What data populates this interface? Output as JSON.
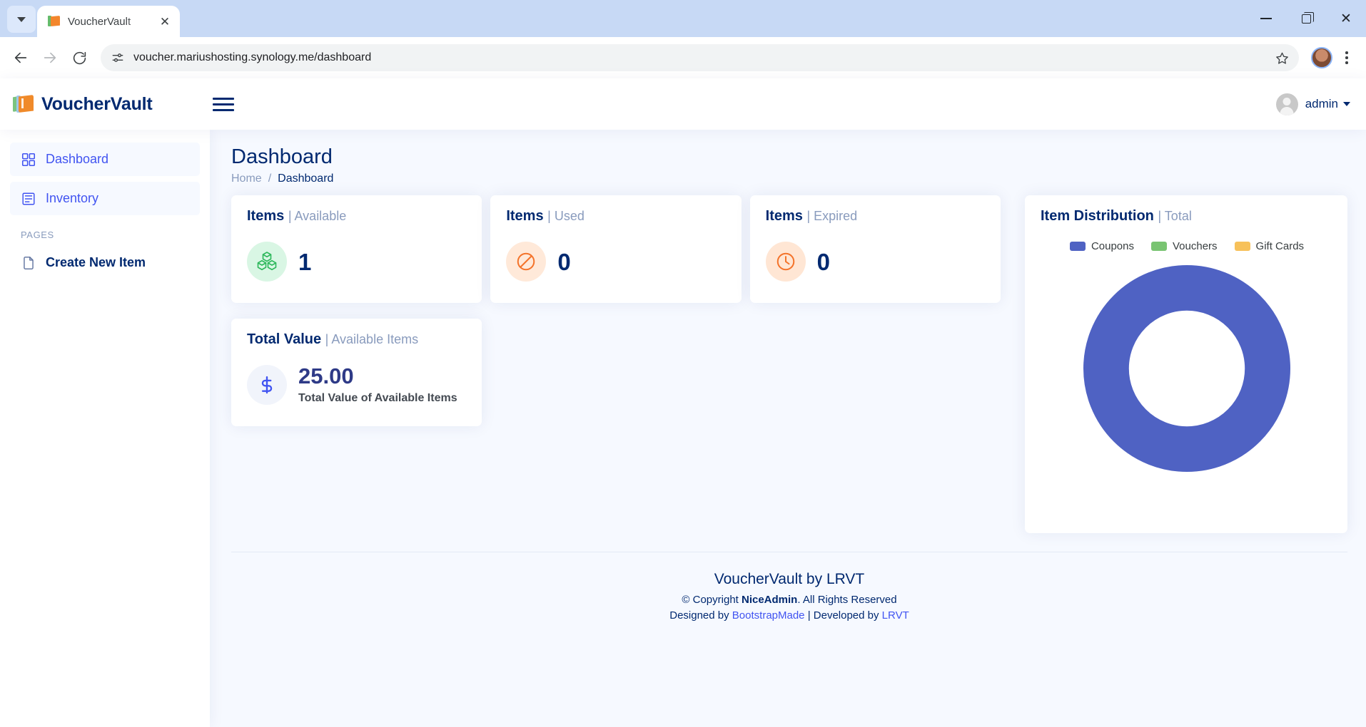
{
  "browser": {
    "tab": {
      "title": "VoucherVault",
      "favicon": "voucher-favicon",
      "close_label": "✕"
    },
    "tab_list_label": "Search tabs",
    "url": "voucher.mariushosting.synology.me/dashboard",
    "back_label": "Back",
    "forward_label": "Forward",
    "reload_label": "Reload",
    "site_info_label": "View site information",
    "bookmark_label": "Bookmark this tab",
    "profile_label": "Profile",
    "menu_label": "Customize and control Google Chrome",
    "window": {
      "minimize": "Minimize",
      "maximize": "Maximize",
      "close": "✕"
    }
  },
  "header": {
    "logo_text": "VoucherVault",
    "toggle_label": "Toggle sidebar",
    "user": {
      "name": "admin",
      "caret": "▾"
    }
  },
  "sidebar": {
    "items": [
      {
        "label": "Dashboard",
        "icon": "grid-icon",
        "active": true
      },
      {
        "label": "Inventory",
        "icon": "list-icon",
        "active": false
      }
    ],
    "section_heading": "PAGES",
    "pages": [
      {
        "label": "Create New Item",
        "icon": "file-icon"
      }
    ]
  },
  "page": {
    "title": "Dashboard",
    "breadcrumb": {
      "home": "Home",
      "separator": "/",
      "current": "Dashboard"
    }
  },
  "cards": [
    {
      "title": "Items",
      "subtitle": "| Available",
      "value": "1",
      "icon": "boxes-icon",
      "icon_color": "#2eb85c",
      "icon_bg": "#d9f6e4"
    },
    {
      "title": "Items",
      "subtitle": "| Used",
      "value": "0",
      "icon": "ban-icon",
      "icon_color": "#f4732a",
      "icon_bg": "#ffe9d9"
    },
    {
      "title": "Items",
      "subtitle": "| Expired",
      "value": "0",
      "icon": "clock-icon",
      "icon_color": "#f4732a",
      "icon_bg": "#ffe6d4"
    }
  ],
  "total_value_card": {
    "title": "Total Value",
    "subtitle": "| Available Items",
    "value": "25.00",
    "caption": "Total Value of Available Items",
    "icon": "dollar-icon",
    "icon_color": "#4154f1",
    "icon_bg": "#f1f4fb"
  },
  "chart_card": {
    "title": "Item Distribution",
    "subtitle": "| Total"
  },
  "chart_data": {
    "type": "pie",
    "variant": "donut",
    "title": "Item Distribution",
    "categories": [
      "Coupons",
      "Vouchers",
      "Gift Cards"
    ],
    "values": [
      1,
      0,
      0
    ],
    "percentages": [
      100,
      0,
      0
    ],
    "colors": [
      "#4f62c3",
      "#79c472",
      "#f7c15a"
    ],
    "legend_position": "top",
    "grid": false,
    "donut_inner_ratio": 0.56
  },
  "footer": {
    "brand": "VoucherVault by LRVT",
    "copyright_prefix": "© Copyright ",
    "copyright_strong": "NiceAdmin",
    "copyright_suffix": ". All Rights Reserved",
    "designed_prefix": "Designed by ",
    "designed_link": "BootstrapMade",
    "pipe": " | ",
    "developed_prefix": "Developed by ",
    "developed_link": "LRVT"
  }
}
